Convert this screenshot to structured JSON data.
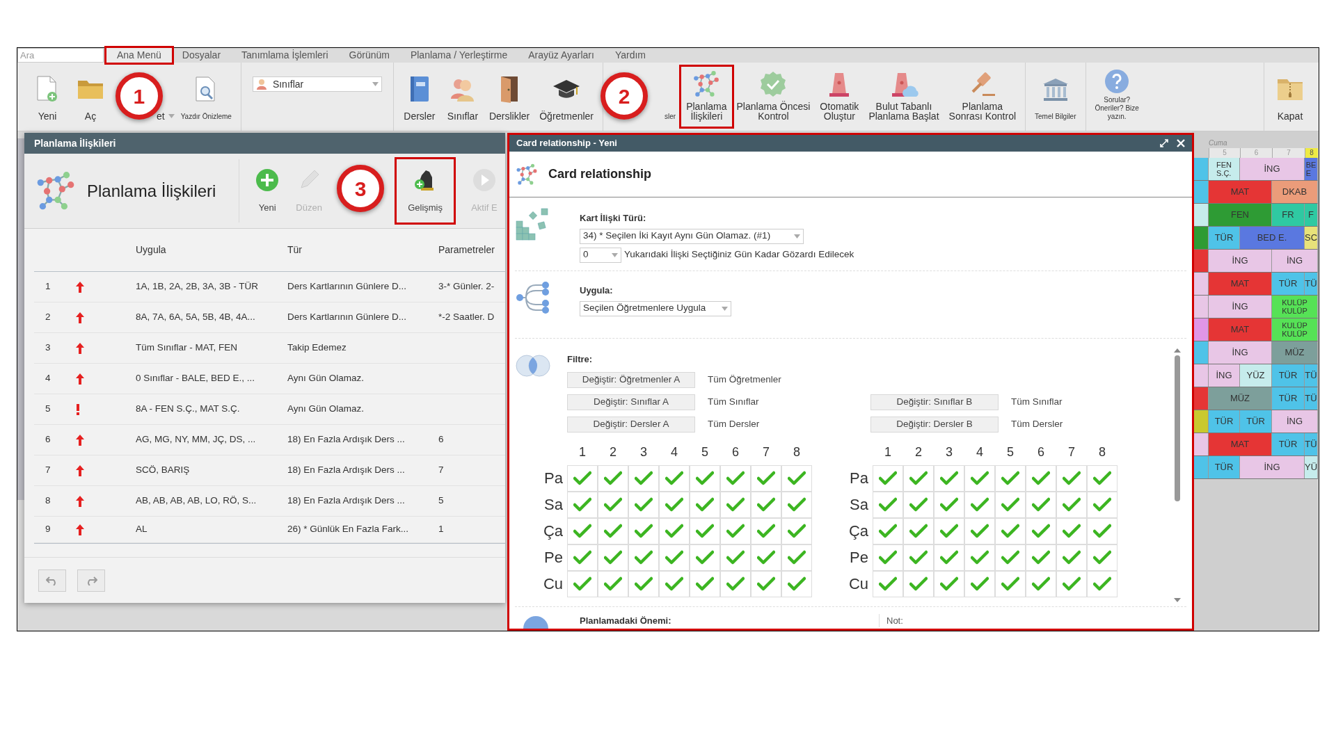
{
  "search": {
    "placeholder": "Ara"
  },
  "menu": [
    {
      "label": "Ana Menü",
      "selected": true,
      "callout": "1"
    },
    {
      "label": "Dosyalar",
      "selected": false
    },
    {
      "label": "Tanımlama İşlemleri",
      "selected": false
    },
    {
      "label": "Görünüm",
      "selected": false
    },
    {
      "label": "Planlama / Yerleştirme",
      "selected": false
    },
    {
      "label": "Arayüz Ayarları",
      "selected": false
    },
    {
      "label": "Yardım",
      "selected": false
    }
  ],
  "toolbar": {
    "groups": [
      {
        "items": [
          {
            "kind": "large",
            "lines": [
              "Yeni"
            ]
          },
          {
            "kind": "large",
            "lines": [
              "Aç"
            ]
          },
          {
            "kind": "split",
            "lines": [
              "et"
            ]
          },
          {
            "kind": "small",
            "lines": [
              "Yazdır Önizleme"
            ]
          }
        ]
      },
      {
        "items": [
          {
            "kind": "select",
            "lines": [
              "Sınıflar"
            ]
          }
        ]
      },
      {
        "items": [
          {
            "kind": "large",
            "lines": [
              "Dersler"
            ]
          },
          {
            "kind": "large",
            "lines": [
              "Sınıflar"
            ]
          },
          {
            "kind": "large",
            "lines": [
              "Derslikler"
            ]
          },
          {
            "kind": "large",
            "lines": [
              "Öğretmenler"
            ]
          }
        ]
      },
      {
        "items": [
          {
            "kind": "small",
            "lines": [
              "sler"
            ]
          },
          {
            "kind": "large",
            "lines": [
              "Planlama",
              "İlişkileri"
            ],
            "callout": "2"
          },
          {
            "kind": "large",
            "lines": [
              "Planlama Öncesi",
              "Kontrol"
            ]
          },
          {
            "kind": "large",
            "lines": [
              "Otomatik",
              "Oluştur"
            ]
          },
          {
            "kind": "large",
            "lines": [
              "Bulut Tabanlı",
              "Planlama Başlat"
            ]
          },
          {
            "kind": "large",
            "lines": [
              "Planlama",
              "Sonrası Kontrol"
            ]
          }
        ]
      },
      {
        "items": [
          {
            "kind": "small",
            "lines": [
              "Temel Bilgiler"
            ]
          }
        ]
      },
      {
        "items": [
          {
            "kind": "small",
            "lines": [
              "Sorular?",
              "Öneriler? Bize",
              "yazın."
            ]
          }
        ]
      },
      {
        "items": [
          {
            "kind": "large",
            "lines": [
              "Kapat"
            ]
          }
        ]
      }
    ]
  },
  "relations_window": {
    "title": "Planlama İlişkileri",
    "heading": "Planlama İlişkileri",
    "actions": [
      {
        "label": "Yeni",
        "disabled": false
      },
      {
        "label": "Düzen",
        "disabled": true
      },
      {
        "label": "Gelişmiş",
        "disabled": false,
        "callout": "3"
      },
      {
        "label": "Aktif E",
        "disabled": true
      }
    ],
    "columns": [
      "Uygula",
      "Tür",
      "Parametreler"
    ],
    "rows": [
      {
        "number": "1",
        "kind": "up",
        "apply": "1A, 1B, 2A, 2B, 3A, 3B - TÜR",
        "type": "Ders Kartlarının Günlere D...",
        "params": "3-* Günler. 2-"
      },
      {
        "number": "2",
        "kind": "up",
        "apply": "8A, 7A, 6A, 5A, 5B, 4B, 4A...",
        "type": "Ders Kartlarının Günlere D...",
        "params": "*-2 Saatler. D"
      },
      {
        "number": "3",
        "kind": "up",
        "apply": "Tüm Sınıflar - MAT, FEN",
        "type": "Takip Edemez"
      },
      {
        "number": "4",
        "kind": "up",
        "apply": "0 Sınıflar - BALE, BED E., ...",
        "type": "Aynı Gün Olamaz."
      },
      {
        "number": "5",
        "kind": "alert",
        "apply": "8A - FEN S.Ç., MAT S.Ç.",
        "type": "Aynı Gün Olamaz."
      },
      {
        "number": "6",
        "kind": "up",
        "apply": "AG, MG, NY, MM, JÇ, DS, ...",
        "type": "18) En Fazla Ardışık Ders ...",
        "params": "6"
      },
      {
        "number": "7",
        "kind": "up",
        "apply": "SCÖ, BARIŞ",
        "type": "18) En Fazla Ardışık Ders ...",
        "params": "7"
      },
      {
        "number": "8",
        "kind": "up",
        "apply": "AB, AB, AB, AB, LO, RÖ, S...",
        "type": "18) En Fazla Ardışık Ders ...",
        "params": "5"
      },
      {
        "number": "9",
        "kind": "up",
        "apply": "AL",
        "type": "26) * Günlük En Fazla Fark...",
        "params": "1"
      }
    ]
  },
  "card_window": {
    "title": "Card relationship - Yeni",
    "heading": "Card relationship",
    "highlighted": true,
    "type_label": "Kart İlişki Türü:",
    "type_value": "34) * Seçilen İki Kayıt Aynı Gün Olamaz. (#1)",
    "ignore_value": "0",
    "ignore_text": "Yukarıdaki İlişki Seçtiğiniz Gün Kadar Gözardı Edilecek",
    "apply_label": "Uygula:",
    "apply_value": "Seçilen Öğretmenlere Uygula",
    "filter_label": "Filtre:",
    "filter_rows": [
      [
        {
          "button": "Değiştir: Öğretmenler A",
          "value": "Tüm Öğretmenler"
        }
      ],
      [
        {
          "button": "Değiştir: Sınıflar A",
          "value": "Tüm Sınıflar"
        },
        {
          "button": "Değiştir: Sınıflar B",
          "value": "Tüm Sınıflar"
        }
      ],
      [
        {
          "button": "Değiştir: Dersler A",
          "value": "Tüm Dersler"
        },
        {
          "button": "Değiştir: Dersler B",
          "value": "Tüm Dersler"
        }
      ]
    ],
    "grids": [
      {
        "columns": [
          "1",
          "2",
          "3",
          "4",
          "5",
          "6",
          "7",
          "8"
        ],
        "rows": [
          {
            "day": "Pa",
            "checked": [
              true,
              true,
              true,
              true,
              true,
              true,
              true,
              true
            ]
          },
          {
            "day": "Sa",
            "checked": [
              true,
              true,
              true,
              true,
              true,
              true,
              true,
              true
            ]
          },
          {
            "day": "Ça",
            "checked": [
              true,
              true,
              true,
              true,
              true,
              true,
              true,
              true
            ]
          },
          {
            "day": "Pe",
            "checked": [
              true,
              true,
              true,
              true,
              true,
              true,
              true,
              true
            ]
          },
          {
            "day": "Cu",
            "checked": [
              true,
              true,
              true,
              true,
              true,
              true,
              true,
              true
            ]
          }
        ]
      },
      {
        "columns": [
          "1",
          "2",
          "3",
          "4",
          "5",
          "6",
          "7",
          "8"
        ],
        "rows": [
          {
            "day": "Pa",
            "checked": [
              true,
              true,
              true,
              true,
              true,
              true,
              true,
              true
            ]
          },
          {
            "day": "Sa",
            "checked": [
              true,
              true,
              true,
              true,
              true,
              true,
              true,
              true
            ]
          },
          {
            "day": "Ça",
            "checked": [
              true,
              true,
              true,
              true,
              true,
              true,
              true,
              true
            ]
          },
          {
            "day": "Pe",
            "checked": [
              true,
              true,
              true,
              true,
              true,
              true,
              true,
              true
            ]
          },
          {
            "day": "Cu",
            "checked": [
              true,
              true,
              true,
              true,
              true,
              true,
              true,
              true
            ]
          }
        ]
      }
    ],
    "importance_label": "Planlamadaki Önemi:",
    "note_label": "Not:"
  },
  "timetable": {
    "day": "Cuma",
    "periods": [
      {
        "label": "5",
        "selected": false
      },
      {
        "label": "6",
        "selected": false
      },
      {
        "label": "7",
        "selected": false
      },
      {
        "label": "8",
        "selected": true
      }
    ],
    "rows": [
      {
        "cells": [
          {
            "color": "#4fc3e8",
            "wide": false
          },
          {
            "lines": [
              "FEN",
              "S.Ç."
            ],
            "color": "#c6ecec",
            "wide": false
          },
          {
            "lines": [
              "İNG"
            ],
            "color": "#e8c6e6",
            "wide": true
          },
          {
            "lines": [
              "BE",
              "E"
            ],
            "color": "#5a78e0",
            "wide": false
          }
        ]
      },
      {
        "cells": [
          {
            "color": "#4fc3e8",
            "wide": false
          },
          {
            "lines": [
              "MAT"
            ],
            "color": "#e53535",
            "wide": true
          },
          {
            "lines": [
              "DKAB"
            ],
            "color": "#eb9c7a",
            "wide": true
          }
        ]
      },
      {
        "cells": [
          {
            "color": "#c6ecec",
            "wide": false
          },
          {
            "lines": [
              "FEN"
            ],
            "color": "#2e9b34",
            "wide": true
          },
          {
            "lines": [
              "FR"
            ],
            "color": "#2fc9a2",
            "wide": false
          },
          {
            "lines": [
              "F"
            ],
            "color": "#2fc9a2",
            "wide": false
          }
        ]
      },
      {
        "cells": [
          {
            "color": "#2e9b34",
            "wide": false
          },
          {
            "lines": [
              "TÜR"
            ],
            "color": "#4fc3e8",
            "wide": false
          },
          {
            "lines": [
              "BED E."
            ],
            "color": "#5a78e0",
            "wide": true
          },
          {
            "lines": [
              "SC"
            ],
            "color": "#e8e27a",
            "wide": false
          }
        ]
      },
      {
        "cells": [
          {
            "color": "#e53535",
            "wide": false
          },
          {
            "lines": [
              "İNG"
            ],
            "color": "#e8c6e6",
            "wide": true
          },
          {
            "lines": [
              "İNG"
            ],
            "color": "#e8c6e6",
            "wide": true
          }
        ]
      },
      {
        "cells": [
          {
            "color": "#e8c6e6",
            "wide": false
          },
          {
            "lines": [
              "MAT"
            ],
            "color": "#e53535",
            "wide": true
          },
          {
            "lines": [
              "TÜR"
            ],
            "color": "#4fc3e8",
            "wide": false
          },
          {
            "lines": [
              "TÜ"
            ],
            "color": "#4fc3e8",
            "wide": false
          }
        ]
      },
      {
        "cells": [
          {
            "color": "#e8c6e6",
            "wide": false
          },
          {
            "lines": [
              "İNG"
            ],
            "color": "#e8c6e6",
            "wide": true
          },
          {
            "lines": [
              "KULÜP",
              "KULÜP"
            ],
            "color": "#56e256",
            "wide": true
          }
        ]
      },
      {
        "cells": [
          {
            "color": "#e095e6",
            "wide": false
          },
          {
            "lines": [
              "MAT"
            ],
            "color": "#e53535",
            "wide": true
          },
          {
            "lines": [
              "KULÜP",
              "KULÜP"
            ],
            "color": "#56e256",
            "wide": true
          }
        ]
      },
      {
        "cells": [
          {
            "color": "#4fc3e8",
            "wide": false
          },
          {
            "lines": [
              "İNG"
            ],
            "color": "#e8c6e6",
            "wide": true
          },
          {
            "lines": [
              "MÜZ"
            ],
            "color": "#7d9f9b",
            "wide": true
          }
        ]
      },
      {
        "cells": [
          {
            "color": "#e8c6e6",
            "wide": false
          },
          {
            "lines": [
              "İNG"
            ],
            "color": "#e8c6e6",
            "wide": false
          },
          {
            "lines": [
              "YÜZ"
            ],
            "color": "#c6ecec",
            "wide": false
          },
          {
            "lines": [
              "TÜR"
            ],
            "color": "#4fc3e8",
            "wide": false
          },
          {
            "lines": [
              "TÜ"
            ],
            "color": "#4fc3e8",
            "wide": false
          }
        ]
      },
      {
        "cells": [
          {
            "color": "#e53535",
            "wide": false
          },
          {
            "lines": [
              "MÜZ"
            ],
            "color": "#7d9f9b",
            "wide": true
          },
          {
            "lines": [
              "TÜR"
            ],
            "color": "#4fc3e8",
            "wide": false
          },
          {
            "lines": [
              "TÜ"
            ],
            "color": "#4fc3e8",
            "wide": false
          }
        ]
      },
      {
        "cells": [
          {
            "color": "#c9c92e",
            "wide": false
          },
          {
            "lines": [
              "TÜR"
            ],
            "color": "#4fc3e8",
            "wide": false
          },
          {
            "lines": [
              "TÜR"
            ],
            "color": "#4fc3e8",
            "wide": false
          },
          {
            "lines": [
              "İNG"
            ],
            "color": "#e8c6e6",
            "wide": true
          }
        ]
      },
      {
        "cells": [
          {
            "color": "#e8c6e6",
            "wide": false
          },
          {
            "lines": [
              "MAT"
            ],
            "color": "#e53535",
            "wide": true
          },
          {
            "lines": [
              "TÜR"
            ],
            "color": "#4fc3e8",
            "wide": false
          },
          {
            "lines": [
              "TÜ"
            ],
            "color": "#4fc3e8",
            "wide": false
          }
        ]
      },
      {
        "cells": [
          {
            "color": "#4fc3e8",
            "wide": false
          },
          {
            "lines": [
              "TÜR"
            ],
            "color": "#4fc3e8",
            "wide": false
          },
          {
            "lines": [
              "İNG"
            ],
            "color": "#e8c6e6",
            "wide": true
          },
          {
            "lines": [
              "YÜ"
            ],
            "color": "#c6ecec",
            "wide": false
          }
        ]
      }
    ]
  }
}
